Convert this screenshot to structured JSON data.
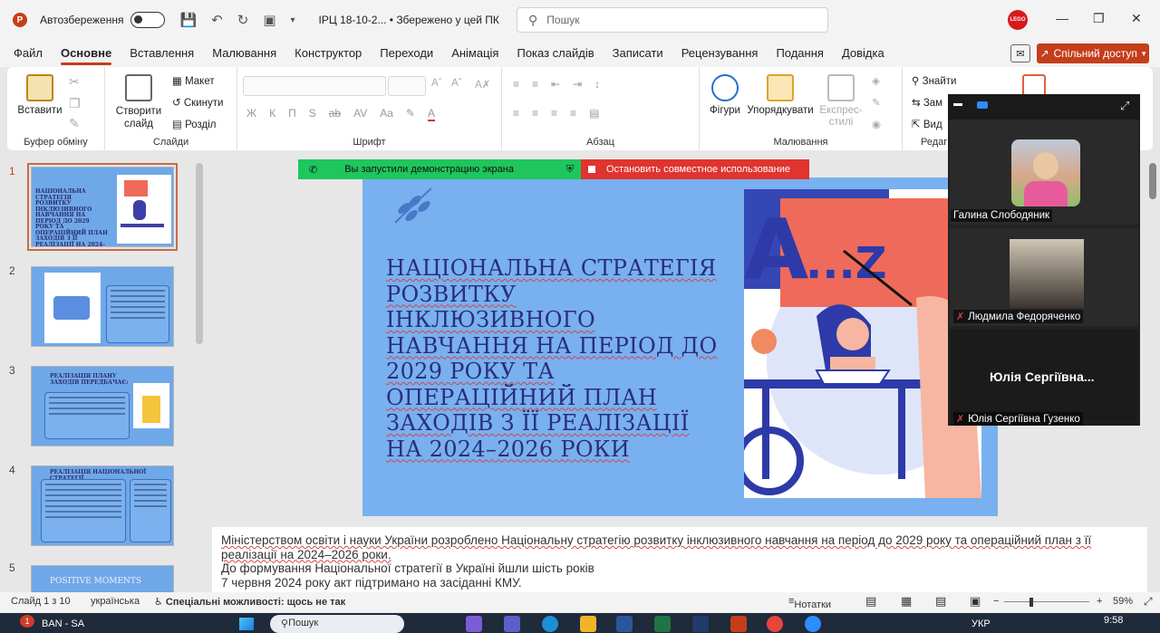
{
  "titlebar": {
    "autosave_label": "Автозбереження",
    "doc_title": "ІРЦ 18-10-2... • Збережено у цей ПК",
    "search_placeholder": "Пошук"
  },
  "menu": {
    "tabs": [
      "Файл",
      "Основне",
      "Вставлення",
      "Малювання",
      "Конструктор",
      "Переходи",
      "Анімація",
      "Показ слайдів",
      "Записати",
      "Рецензування",
      "Подання",
      "Довідка"
    ],
    "active_tab": "Основне",
    "share_label": "Спільний доступ"
  },
  "ribbon": {
    "paste": "Вставити",
    "clipboard_group": "Буфер обміну",
    "new_slide": "Створити слайд",
    "layout": "Макет",
    "reset": "Скинути",
    "section": "Розділ",
    "slides_group": "Слайди",
    "font_group": "Шрифт",
    "paragraph_group": "Абзац",
    "shapes": "Фігури",
    "arrange": "Упорядкувати",
    "quick_styles": "Експрес-стилі",
    "drawing_group": "Малювання",
    "find": "Знайти",
    "replace": "Зам",
    "select": "Вид",
    "editing_group": "Редаг",
    "font_buttons": [
      "Ж",
      "К",
      "П",
      "S",
      "ab",
      "AV",
      "Aa"
    ]
  },
  "share_banner": {
    "started": "Вы запустили демонстрацию экрана",
    "stop": "Остановить совместное использование"
  },
  "thumbnails": {
    "numbers": [
      "1",
      "2",
      "3",
      "4",
      "5"
    ],
    "t1": "НАЦІОНАЛЬНА СТРАТЕГІЯ РОЗВИТКУ ІНКЛЮЗИВНОГО НАВЧАННЯ НА ПЕРІОД ДО 2029 РОКУ ТА ОПЕРАЦІЙНИЙ ПЛАН ЗАХОДІВ З ЇЇ РЕАЛІЗАЦІЇ НА 2024–2026 РОКИ",
    "t3": "РЕАЛІЗАЦІЯ ПЛАНУ ЗАХОДІВ ПЕРЕДБАЧАЄ:",
    "t4": "РЕАЛІЗАЦІЯ НАЦІОНАЛЬНОЇ СТРАТЕГІЇ",
    "t5": "POSITIVE MOMENTS"
  },
  "slide": {
    "title": "НАЦІОНАЛЬНА СТРАТЕГІЯ РОЗВИТКУ ІНКЛЮЗИВНОГО НАВЧАННЯ НА ПЕРІОД ДО 2029 РОКУ ТА ОПЕРАЦІЙНИЙ ПЛАН ЗАХОДІВ З ЇЇ РЕАЛІЗАЦІЇ НА 2024–2026 РОКИ",
    "illus_letter_a": "A",
    "illus_letters": "...Z"
  },
  "notes": {
    "line1": "Міністерством освіти і науки України розроблено Національну стратегію розвитку інклюзивного навчання на період до 2029 року та операційний план з її реалізації на 2024–2026 роки.",
    "line2": "До формування Національної стратегії в Україні йшли шість років",
    "line3": "7 червня 2024 року акт підтримано на засіданні КМУ."
  },
  "zoom": {
    "p1": "Галина Слободяник",
    "p2": "Людмила Федоряченко",
    "p3_big": "Юлія Сергіївна...",
    "p3": "Юлія Сергіївна Гузенко"
  },
  "status": {
    "slide_count": "Слайд 1 з 10",
    "language": "українська",
    "accessibility": "Спеціальні можливості: щось не так",
    "notes": "Нотатки",
    "zoom": "59%"
  },
  "taskbar": {
    "badge": "1",
    "ticker": "BAN - SA",
    "search": "Пошук",
    "lang": "УКР",
    "time": "9:58"
  },
  "colors": {
    "accent": "#c43e1c",
    "slide_bg": "#79b0f0",
    "title_text": "#2a2e7a"
  }
}
